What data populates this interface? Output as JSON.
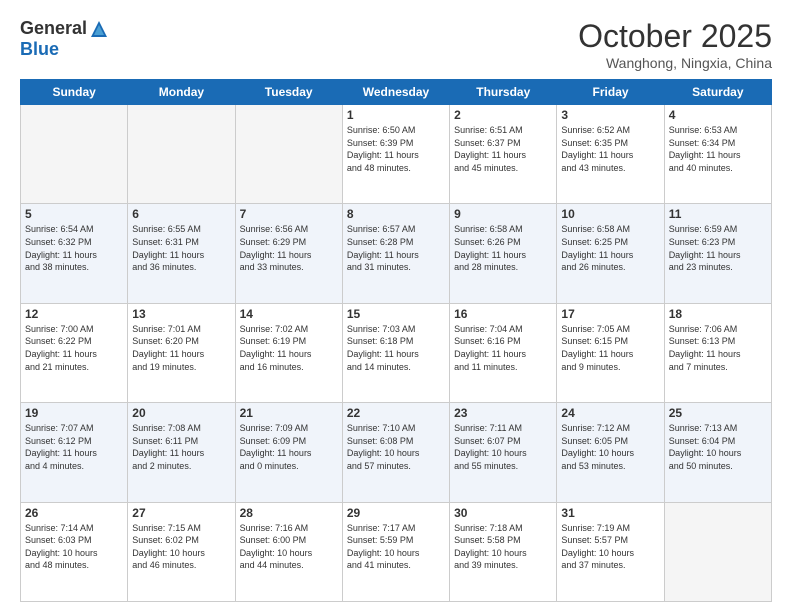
{
  "header": {
    "logo_general": "General",
    "logo_blue": "Blue",
    "month_title": "October 2025",
    "location": "Wanghong, Ningxia, China"
  },
  "weekdays": [
    "Sunday",
    "Monday",
    "Tuesday",
    "Wednesday",
    "Thursday",
    "Friday",
    "Saturday"
  ],
  "weeks": [
    [
      {
        "day": "",
        "info": ""
      },
      {
        "day": "",
        "info": ""
      },
      {
        "day": "",
        "info": ""
      },
      {
        "day": "1",
        "info": "Sunrise: 6:50 AM\nSunset: 6:39 PM\nDaylight: 11 hours\nand 48 minutes."
      },
      {
        "day": "2",
        "info": "Sunrise: 6:51 AM\nSunset: 6:37 PM\nDaylight: 11 hours\nand 45 minutes."
      },
      {
        "day": "3",
        "info": "Sunrise: 6:52 AM\nSunset: 6:35 PM\nDaylight: 11 hours\nand 43 minutes."
      },
      {
        "day": "4",
        "info": "Sunrise: 6:53 AM\nSunset: 6:34 PM\nDaylight: 11 hours\nand 40 minutes."
      }
    ],
    [
      {
        "day": "5",
        "info": "Sunrise: 6:54 AM\nSunset: 6:32 PM\nDaylight: 11 hours\nand 38 minutes."
      },
      {
        "day": "6",
        "info": "Sunrise: 6:55 AM\nSunset: 6:31 PM\nDaylight: 11 hours\nand 36 minutes."
      },
      {
        "day": "7",
        "info": "Sunrise: 6:56 AM\nSunset: 6:29 PM\nDaylight: 11 hours\nand 33 minutes."
      },
      {
        "day": "8",
        "info": "Sunrise: 6:57 AM\nSunset: 6:28 PM\nDaylight: 11 hours\nand 31 minutes."
      },
      {
        "day": "9",
        "info": "Sunrise: 6:58 AM\nSunset: 6:26 PM\nDaylight: 11 hours\nand 28 minutes."
      },
      {
        "day": "10",
        "info": "Sunrise: 6:58 AM\nSunset: 6:25 PM\nDaylight: 11 hours\nand 26 minutes."
      },
      {
        "day": "11",
        "info": "Sunrise: 6:59 AM\nSunset: 6:23 PM\nDaylight: 11 hours\nand 23 minutes."
      }
    ],
    [
      {
        "day": "12",
        "info": "Sunrise: 7:00 AM\nSunset: 6:22 PM\nDaylight: 11 hours\nand 21 minutes."
      },
      {
        "day": "13",
        "info": "Sunrise: 7:01 AM\nSunset: 6:20 PM\nDaylight: 11 hours\nand 19 minutes."
      },
      {
        "day": "14",
        "info": "Sunrise: 7:02 AM\nSunset: 6:19 PM\nDaylight: 11 hours\nand 16 minutes."
      },
      {
        "day": "15",
        "info": "Sunrise: 7:03 AM\nSunset: 6:18 PM\nDaylight: 11 hours\nand 14 minutes."
      },
      {
        "day": "16",
        "info": "Sunrise: 7:04 AM\nSunset: 6:16 PM\nDaylight: 11 hours\nand 11 minutes."
      },
      {
        "day": "17",
        "info": "Sunrise: 7:05 AM\nSunset: 6:15 PM\nDaylight: 11 hours\nand 9 minutes."
      },
      {
        "day": "18",
        "info": "Sunrise: 7:06 AM\nSunset: 6:13 PM\nDaylight: 11 hours\nand 7 minutes."
      }
    ],
    [
      {
        "day": "19",
        "info": "Sunrise: 7:07 AM\nSunset: 6:12 PM\nDaylight: 11 hours\nand 4 minutes."
      },
      {
        "day": "20",
        "info": "Sunrise: 7:08 AM\nSunset: 6:11 PM\nDaylight: 11 hours\nand 2 minutes."
      },
      {
        "day": "21",
        "info": "Sunrise: 7:09 AM\nSunset: 6:09 PM\nDaylight: 11 hours\nand 0 minutes."
      },
      {
        "day": "22",
        "info": "Sunrise: 7:10 AM\nSunset: 6:08 PM\nDaylight: 10 hours\nand 57 minutes."
      },
      {
        "day": "23",
        "info": "Sunrise: 7:11 AM\nSunset: 6:07 PM\nDaylight: 10 hours\nand 55 minutes."
      },
      {
        "day": "24",
        "info": "Sunrise: 7:12 AM\nSunset: 6:05 PM\nDaylight: 10 hours\nand 53 minutes."
      },
      {
        "day": "25",
        "info": "Sunrise: 7:13 AM\nSunset: 6:04 PM\nDaylight: 10 hours\nand 50 minutes."
      }
    ],
    [
      {
        "day": "26",
        "info": "Sunrise: 7:14 AM\nSunset: 6:03 PM\nDaylight: 10 hours\nand 48 minutes."
      },
      {
        "day": "27",
        "info": "Sunrise: 7:15 AM\nSunset: 6:02 PM\nDaylight: 10 hours\nand 46 minutes."
      },
      {
        "day": "28",
        "info": "Sunrise: 7:16 AM\nSunset: 6:00 PM\nDaylight: 10 hours\nand 44 minutes."
      },
      {
        "day": "29",
        "info": "Sunrise: 7:17 AM\nSunset: 5:59 PM\nDaylight: 10 hours\nand 41 minutes."
      },
      {
        "day": "30",
        "info": "Sunrise: 7:18 AM\nSunset: 5:58 PM\nDaylight: 10 hours\nand 39 minutes."
      },
      {
        "day": "31",
        "info": "Sunrise: 7:19 AM\nSunset: 5:57 PM\nDaylight: 10 hours\nand 37 minutes."
      },
      {
        "day": "",
        "info": ""
      }
    ]
  ]
}
